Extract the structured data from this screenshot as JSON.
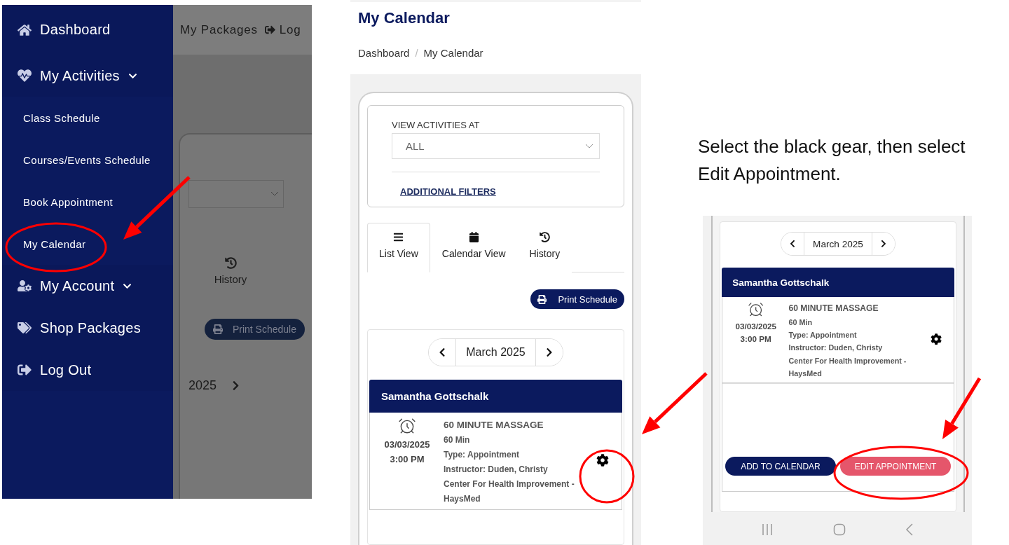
{
  "menu_screenshot": {
    "sidebar": [
      {
        "label": "Dashboard",
        "kind": "link"
      },
      {
        "label": "My Activities",
        "kind": "group",
        "children": [
          {
            "label": "Class Schedule"
          },
          {
            "label": "Courses/Events Schedule"
          },
          {
            "label": "Book Appointment"
          },
          {
            "label": "My Calendar"
          }
        ]
      },
      {
        "label": "My Account",
        "kind": "group"
      },
      {
        "label": "Shop Packages",
        "kind": "link"
      },
      {
        "label": "Log Out",
        "kind": "link"
      }
    ],
    "behind": {
      "nav_links": [
        "My Packages",
        "Log"
      ],
      "tab": "History",
      "print_button": "Print Schedule",
      "month": "2025"
    }
  },
  "calendar_screenshot": {
    "title": "My Calendar",
    "breadcrumb": [
      "Dashboard",
      "My Calendar"
    ],
    "separator": "/",
    "filter": {
      "label": "VIEW ACTIVITIES AT",
      "value": "ALL",
      "link": "ADDITIONAL FILTERS"
    },
    "tabs": [
      {
        "label": "List View",
        "selected": true
      },
      {
        "label": "Calendar View",
        "selected": false
      },
      {
        "label": "History",
        "selected": false
      }
    ],
    "print_button": "Print Schedule",
    "month": "March 2025",
    "appointment": {
      "client": "Samantha Gottschalk",
      "date": "03/03/2025",
      "time": "3:00 PM",
      "title": "60 MINUTE MASSAGE",
      "details": [
        "60 Min",
        "Type: Appointment",
        "Instructor: Duden, Christy",
        "Center For Health Improvement -",
        "HaysMed"
      ]
    }
  },
  "instruction": "Select the black gear, then select Edit Appointment.",
  "detail_screenshot": {
    "month": "March 2025",
    "appointment": {
      "client": "Samantha Gottschalk",
      "date": "03/03/2025",
      "time": "3:00 PM",
      "title": "60 MINUTE MASSAGE",
      "details": [
        "60 Min",
        "Type: Appointment",
        "Instructor: Duden, Christy",
        "Center For Health Improvement -",
        "HaysMed"
      ]
    },
    "buttons": [
      {
        "label": "ADD TO CALENDAR",
        "kind": "primary"
      },
      {
        "label": "EDIT APPOINTMENT",
        "kind": "danger"
      }
    ]
  }
}
